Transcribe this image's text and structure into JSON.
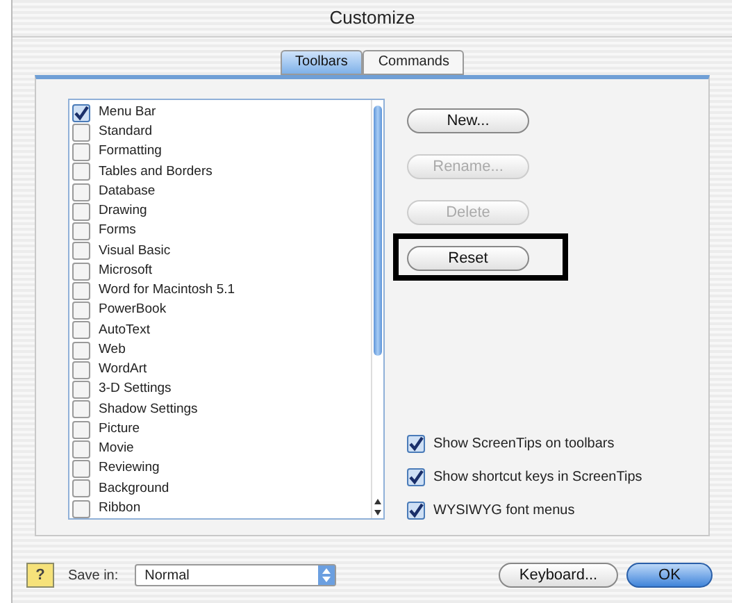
{
  "window": {
    "title": "Customize"
  },
  "tabs": [
    {
      "label": "Toolbars",
      "selected": true
    },
    {
      "label": "Commands",
      "selected": false
    }
  ],
  "toolbars": [
    {
      "label": "Menu Bar",
      "checked": true
    },
    {
      "label": "Standard",
      "checked": false
    },
    {
      "label": "Formatting",
      "checked": false
    },
    {
      "label": "Tables and Borders",
      "checked": false
    },
    {
      "label": "Database",
      "checked": false
    },
    {
      "label": "Drawing",
      "checked": false
    },
    {
      "label": "Forms",
      "checked": false
    },
    {
      "label": "Visual Basic",
      "checked": false
    },
    {
      "label": "Microsoft",
      "checked": false
    },
    {
      "label": "Word for Macintosh 5.1",
      "checked": false
    },
    {
      "label": "PowerBook",
      "checked": false
    },
    {
      "label": "AutoText",
      "checked": false
    },
    {
      "label": "Web",
      "checked": false
    },
    {
      "label": "WordArt",
      "checked": false
    },
    {
      "label": "3-D Settings",
      "checked": false
    },
    {
      "label": "Shadow Settings",
      "checked": false
    },
    {
      "label": "Picture",
      "checked": false
    },
    {
      "label": "Movie",
      "checked": false
    },
    {
      "label": "Reviewing",
      "checked": false
    },
    {
      "label": "Background",
      "checked": false
    },
    {
      "label": "Ribbon",
      "checked": false
    }
  ],
  "buttons": [
    {
      "label": "New...",
      "disabled": false,
      "highlighted": false
    },
    {
      "label": "Rename...",
      "disabled": true,
      "highlighted": false
    },
    {
      "label": "Delete",
      "disabled": true,
      "highlighted": false
    },
    {
      "label": "Reset",
      "disabled": false,
      "highlighted": true
    }
  ],
  "options": [
    {
      "label": "Show ScreenTips on toolbars",
      "checked": true
    },
    {
      "label": "Show shortcut keys in ScreenTips",
      "checked": true
    },
    {
      "label": "WYSIWYG font menus",
      "checked": true
    }
  ],
  "footer": {
    "help": "?",
    "save_in_label": "Save in:",
    "save_in_value": "Normal",
    "keyboard_button": "Keyboard...",
    "ok_button": "OK"
  }
}
